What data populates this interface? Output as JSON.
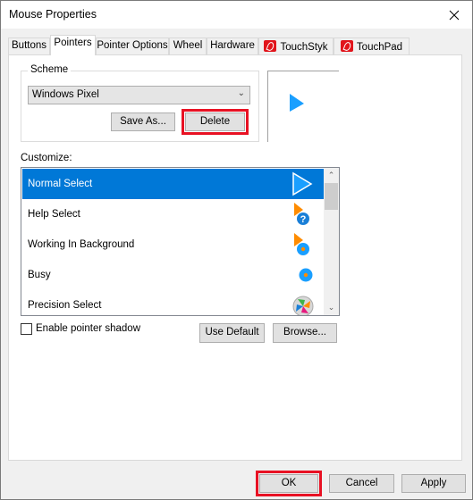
{
  "window": {
    "title": "Mouse Properties"
  },
  "tabs": [
    {
      "label": "Buttons",
      "active": false
    },
    {
      "label": "Pointers",
      "active": true
    },
    {
      "label": "Pointer Options",
      "active": false
    },
    {
      "label": "Wheel",
      "active": false
    },
    {
      "label": "Hardware",
      "active": false
    },
    {
      "label": "TouchStyk",
      "active": false,
      "icon": "touchstyk-logo-icon"
    },
    {
      "label": "TouchPad",
      "active": false,
      "icon": "touchpad-logo-icon"
    }
  ],
  "scheme": {
    "group_label": "Scheme",
    "selected": "Windows Pixel",
    "save_as_label": "Save As...",
    "delete_label": "Delete"
  },
  "customize": {
    "label": "Customize:",
    "items": [
      {
        "label": "Normal Select",
        "icon": "normal-select-cursor-icon",
        "selected": true
      },
      {
        "label": "Help Select",
        "icon": "help-select-cursor-icon",
        "selected": false
      },
      {
        "label": "Working In Background",
        "icon": "working-background-cursor-icon",
        "selected": false
      },
      {
        "label": "Busy",
        "icon": "busy-cursor-icon",
        "selected": false
      },
      {
        "label": "Precision Select",
        "icon": "precision-select-cursor-icon",
        "selected": false
      }
    ]
  },
  "shadow": {
    "label": "Enable pointer shadow",
    "checked": false
  },
  "use_default_label": "Use Default",
  "browse_label": "Browse...",
  "footer": {
    "ok_label": "OK",
    "cancel_label": "Cancel",
    "apply_label": "Apply"
  },
  "colors": {
    "accent": "#0078d7",
    "highlight": "#e81123",
    "cursor_blue": "#1a9fff",
    "cursor_orange": "#ff8c00"
  }
}
